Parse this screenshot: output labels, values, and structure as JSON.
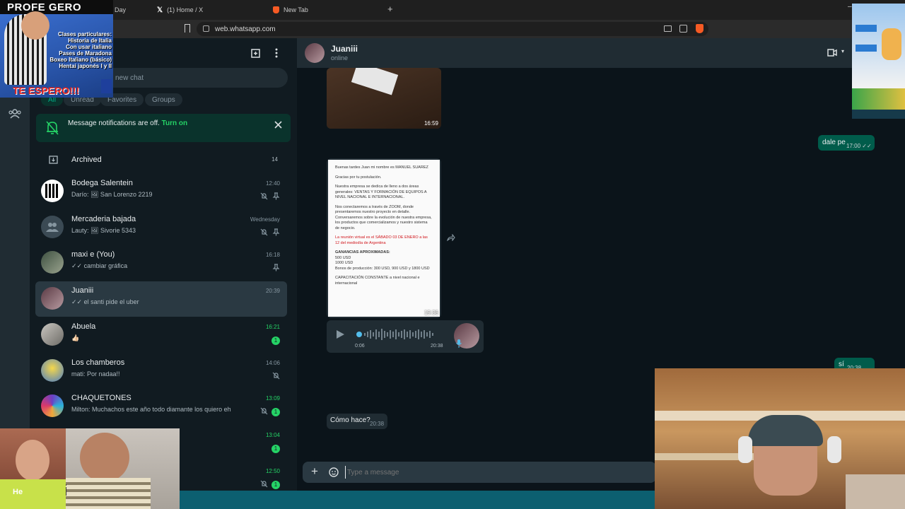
{
  "browser": {
    "tabs": [
      {
        "label": "Day"
      },
      {
        "label": "(1) Home / X"
      },
      {
        "label": "New Tab"
      }
    ],
    "new_tab_symbol": "+",
    "url": "web.whatsapp.com"
  },
  "overlay": {
    "profe_title": "PROFE GERO",
    "profe_lines": [
      "Clases particulares:",
      "Historia de Italia",
      "Con usar italiano",
      "Pases de Maradona",
      "Boxeo Italiano (básico)",
      "Hentai japonés I y II"
    ],
    "profe_footer": "TE ESPERO!!!",
    "webcam_left_text": "ntai",
    "webcam_left_text_small": "He"
  },
  "sidebar": {
    "search_placeholder": "new chat",
    "filters": [
      "All",
      "Unread",
      "Favorites",
      "Groups"
    ],
    "notification": {
      "text": "Message notifications are off.",
      "link": "Turn on"
    },
    "archived": {
      "label": "Archived",
      "count": "14"
    },
    "chats": [
      {
        "name": "Bodega Salentein",
        "preview": "Darío: 🖼 San Lorenzo 2219",
        "time": "12:40",
        "unread": "",
        "icons": [
          "mute",
          "pin"
        ]
      },
      {
        "name": "Mercaderia bajada",
        "preview": "Lauty: 🖼 Sivorie 5343",
        "time": "Wednesday",
        "unread": "",
        "icons": [
          "mute",
          "pin"
        ]
      },
      {
        "name": "maxi e (You)",
        "preview": "✓✓ cambiar gráfica",
        "time": "16:18",
        "unread": "",
        "icons": [
          "pin"
        ]
      },
      {
        "name": "Juaniii",
        "preview": "✓✓ el santi pide el uber",
        "time": "20:39",
        "unread": "",
        "icons": []
      },
      {
        "name": "Abuela",
        "preview": "👍🏻",
        "time": "16:21",
        "unread": "1",
        "icons": []
      },
      {
        "name": "Los chamberos",
        "preview": "mati: Por nadaa!!",
        "time": "14:06",
        "unread": "",
        "icons": [
          "mute"
        ]
      },
      {
        "name": "CHAQUETONES",
        "preview": "Milton: Muchachos este año todo diamante los quiero eh",
        "time": "13:09",
        "unread": "1",
        "icons": [
          "mute"
        ]
      },
      {
        "name": "",
        "preview": "",
        "time": "13:04",
        "unread": "1",
        "icons": []
      },
      {
        "name": "",
        "preview": "",
        "time": "12:50",
        "unread": "1",
        "icons": [
          "mute"
        ]
      }
    ]
  },
  "conversation": {
    "contact_name": "Juaniii",
    "status": "online",
    "messages": {
      "image1_time": "16:59",
      "out1_text": "dale pe",
      "out1_time": "17:00 ✓✓",
      "doc_time": "19:36",
      "doc_lines": [
        "Buenas tardes Juan mi nombre es MANUEL SUAREZ",
        "Gracias por tu postulación.",
        "Nuestra empresa se dedica de lleno a dos áreas generales: VENTAS Y FORMACIÓN DE EQUIPOS A NIVEL NACIONAL E INTERNACIONAL.",
        "Nos conectaremos a través de ZOOM, donde presentaremos nuestro proyecto en detalle. Conversaremos sobre la evolución de nuestra empresa, los productos que comercializamos y nuestro sistema de negocio.",
        "La reunión virtual es el SÁBADO 03 DE ENERO a las 12 del mediodía de Argentina",
        "GANANCIAS APROXIMADAS:",
        "500 USD",
        "1000 USD",
        "Bonos de producción: 300 USD, 900 USD y 1800 USD",
        "CAPACITACIÓN CONSTANTE a nivel nacional e internacional"
      ],
      "voice_duration": "0:06",
      "voice_time": "20:38",
      "out2_text": "sí",
      "out2_time": "20:38",
      "in_text": "Cómo hace?",
      "in_time": "20:38"
    },
    "composer_placeholder": "Type a message"
  },
  "colors": {
    "accent": "#00a884",
    "bubble_out": "#005c4b",
    "bubble_in": "#202c33",
    "panel": "#111b21"
  }
}
